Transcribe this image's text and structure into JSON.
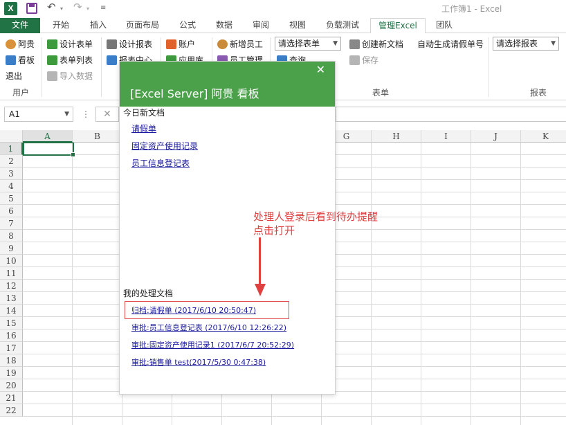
{
  "window": {
    "title": "工作簿1 - Excel"
  },
  "quick_access": {
    "app_icon": "excel-logo-icon",
    "logo_letter": "X",
    "icons": [
      "save-icon",
      "undo-icon",
      "redo-icon",
      "customize-icon"
    ]
  },
  "tabs": [
    {
      "label": "文件"
    },
    {
      "label": "开始"
    },
    {
      "label": "插入"
    },
    {
      "label": "页面布局"
    },
    {
      "label": "公式"
    },
    {
      "label": "数据"
    },
    {
      "label": "审阅"
    },
    {
      "label": "视图"
    },
    {
      "label": "负载测试"
    },
    {
      "label": "管理Excel"
    },
    {
      "label": "团队"
    }
  ],
  "ribbon": {
    "user": {
      "items": [
        "阿贵",
        "看板",
        "退出"
      ],
      "group": "用户"
    },
    "design": {
      "items": [
        "设计表单",
        "表单列表",
        "导入数据"
      ]
    },
    "report": {
      "items": [
        "设计报表",
        "报表中心"
      ]
    },
    "app": {
      "items": [
        "账户",
        "应用库"
      ]
    },
    "staff": {
      "items": [
        "新增员工",
        "员工管理"
      ]
    },
    "form": {
      "select_form_placeholder": "请选择表单",
      "query": "查询",
      "create_doc": "创建新文档",
      "save": "保存",
      "auto_gen": "自动生成请假单号",
      "group": "表单"
    },
    "report_group": {
      "select_report_placeholder": "请选择报表",
      "group": "报表"
    }
  },
  "formula_bar": {
    "name_box": "A1",
    "cancel": "✕",
    "dots": "⋮"
  },
  "grid": {
    "columns": [
      "A",
      "B",
      "C",
      "D",
      "E",
      "F",
      "G",
      "H",
      "I",
      "J",
      "K"
    ],
    "rows": [
      "1",
      "2",
      "3",
      "4",
      "5",
      "6",
      "7",
      "8",
      "9",
      "10",
      "11",
      "12",
      "13",
      "14",
      "15",
      "16",
      "17",
      "18",
      "19",
      "20",
      "21",
      "22"
    ],
    "active_cell": "A1"
  },
  "dialog": {
    "title": "[Excel Server] 阿贵 看板",
    "close": "✕",
    "today_section": "今日新文档",
    "today_docs": [
      "请假单",
      "固定资产使用记录",
      "员工信息登记表"
    ],
    "my_section": "我的处理文档",
    "my_docs": [
      "归档:请假单 (2017/6/10 20:50:47)",
      "审批:员工信息登记表 (2017/6/10 12:26:22)",
      "审批:固定资产使用记录1 (2017/6/7 20:52:29)",
      "审批:销售单 test(2017/5/30 0:47:38)"
    ]
  },
  "annotation": {
    "text": "处理人登录后看到待办提醒\n点击打开",
    "color": "#e04040"
  },
  "colors": {
    "excel_green": "#217346",
    "dialog_header": "#4aa14a",
    "link": "#1a1a9c"
  }
}
